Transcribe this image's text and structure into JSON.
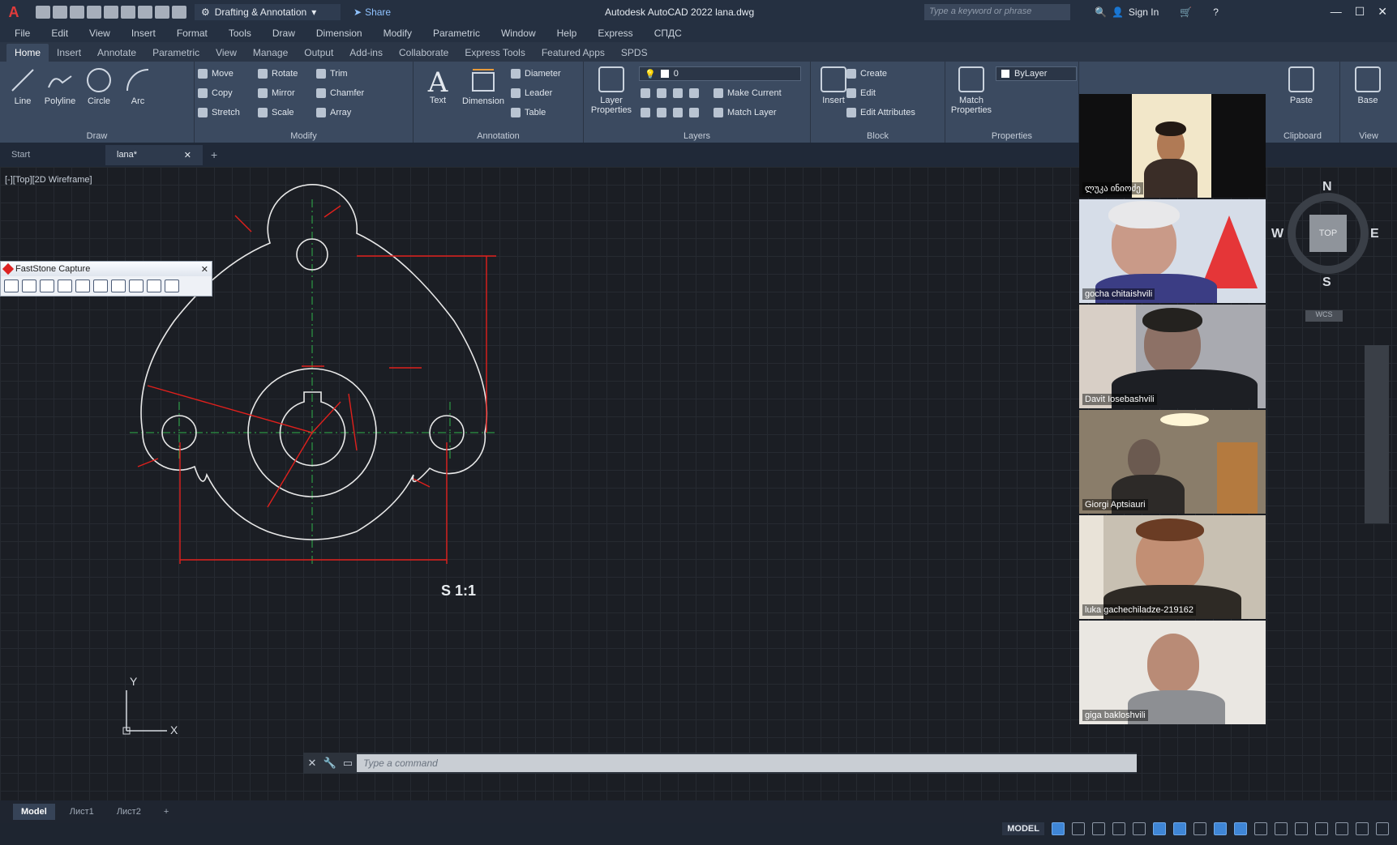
{
  "titlebar": {
    "workspace": "Drafting & Annotation",
    "share_label": "Share",
    "app_title": "Autodesk AutoCAD 2022   lana.dwg",
    "search_placeholder": "Type a keyword or phrase",
    "signin_label": "Sign In"
  },
  "menubar": {
    "items": [
      "File",
      "Edit",
      "View",
      "Insert",
      "Format",
      "Tools",
      "Draw",
      "Dimension",
      "Modify",
      "Parametric",
      "Window",
      "Help",
      "Express",
      "СПДС"
    ]
  },
  "ribbon_tabs": [
    "Home",
    "Insert",
    "Annotate",
    "Parametric",
    "View",
    "Manage",
    "Output",
    "Add-ins",
    "Collaborate",
    "Express Tools",
    "Featured Apps",
    "SPDS"
  ],
  "ribbon": {
    "draw": {
      "title": "Draw",
      "line": "Line",
      "polyline": "Polyline",
      "circle": "Circle",
      "arc": "Arc"
    },
    "modify": {
      "title": "Modify",
      "move": "Move",
      "rotate": "Rotate",
      "trim": "Trim",
      "copy": "Copy",
      "mirror": "Mirror",
      "chamfer": "Chamfer",
      "stretch": "Stretch",
      "scale": "Scale",
      "array": "Array"
    },
    "annotation": {
      "title": "Annotation",
      "text": "Text",
      "dimension": "Dimension",
      "diameter": "Diameter",
      "leader": "Leader",
      "table": "Table"
    },
    "layers": {
      "title": "Layers",
      "layer_properties_1": "Layer",
      "layer_properties_2": "Properties",
      "layer_value": "0",
      "make_current": "Make Current",
      "match_layer": "Match Layer"
    },
    "block": {
      "title": "Block",
      "insert": "Insert",
      "create": "Create",
      "edit": "Edit",
      "edit_attributes": "Edit Attributes"
    },
    "properties": {
      "title": "Properties",
      "match_1": "Match",
      "match_2": "Properties",
      "bylayer": "ByLayer"
    },
    "clipboard": {
      "title": "Clipboard",
      "paste": "Paste"
    },
    "view": {
      "title": "View",
      "base": "Base"
    }
  },
  "file_tabs": {
    "start": "Start",
    "active": "lana*"
  },
  "canvas": {
    "viewport_label": "[-][Top][2D Wireframe]",
    "scale_label": "S 1:1",
    "ucs_y": "Y",
    "ucs_x": "X"
  },
  "faststone": {
    "title": "FastStone Capture"
  },
  "viewcube": {
    "n": "N",
    "s": "S",
    "e": "E",
    "w": "W",
    "top": "TOP",
    "wcs": "WCS"
  },
  "participants": [
    {
      "name": "ლუკა ინიოძე"
    },
    {
      "name": "gocha chitaishvili"
    },
    {
      "name": "Davit Iosebashvili"
    },
    {
      "name": "Giorgi Aptsiauri"
    },
    {
      "name": "luka gachechiladze-219162"
    },
    {
      "name": "giga bakloshvili"
    }
  ],
  "command_line": {
    "placeholder": "Type a command"
  },
  "layout_tabs": [
    "Model",
    "Лист1",
    "Лист2"
  ],
  "status": {
    "model": "MODEL"
  },
  "colors": {
    "accent": "#3f86d6",
    "drawing_red": "#e0201c",
    "drawing_white": "#e8e8e8",
    "drawing_green": "#2fb34a"
  }
}
